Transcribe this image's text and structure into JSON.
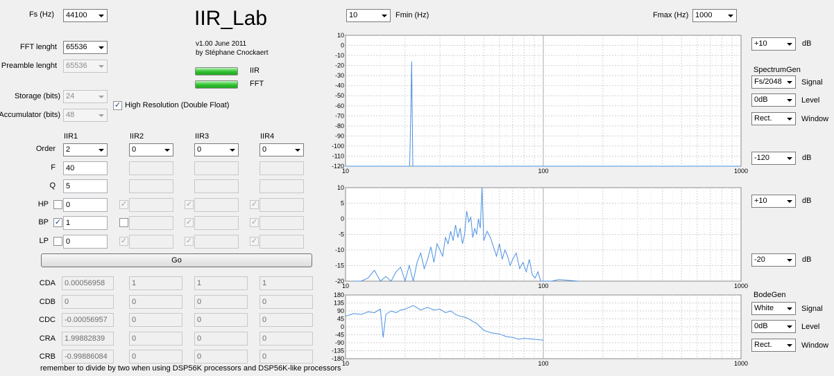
{
  "app": {
    "title": "IIR_Lab",
    "version": "v1.00 June 2011",
    "author": "by Stéphane Cnockaert"
  },
  "settings": {
    "fs_label": "Fs (Hz)",
    "fs_value": "44100",
    "fft_label": "FFT lenght",
    "fft_value": "65536",
    "preamble_label": "Preamble lenght",
    "preamble_value": "65536",
    "storage_label": "Storage (bits)",
    "storage_value": "24",
    "accumulator_label": "Accumulator (bits)",
    "accumulator_value": "48",
    "highres_label": "High Resolution (Double Float)",
    "highres_checked": "✓"
  },
  "indicators": {
    "iir": "IIR",
    "fft": "FFT",
    "green": "#2fc12f"
  },
  "filters": {
    "row_labels": {
      "order": "Order",
      "f": "F",
      "q": "Q",
      "hp": "HP",
      "bp": "BP",
      "lp": "LP"
    },
    "columns": [
      {
        "name": "IIR1",
        "order": "2",
        "f": "40",
        "q": "5",
        "hp": "0",
        "bp": "1",
        "lp": "0",
        "hp_chk": "",
        "bp_chk": "✓",
        "lp_chk": ""
      },
      {
        "name": "IIR2",
        "order": "0",
        "f": "",
        "q": "",
        "hp": "",
        "bp": "",
        "lp": "",
        "hp_chk": "✓",
        "bp_chk": "",
        "lp_chk": "✓"
      },
      {
        "name": "IIR3",
        "order": "0",
        "f": "",
        "q": "",
        "hp": "",
        "bp": "",
        "lp": "",
        "hp_chk": "✓",
        "bp_chk": "✓",
        "lp_chk": "✓"
      },
      {
        "name": "IIR4",
        "order": "0",
        "f": "",
        "q": "",
        "hp": "",
        "bp": "",
        "lp": "",
        "hp_chk": "✓",
        "bp_chk": "✓",
        "lp_chk": "✓"
      }
    ],
    "go_label": "Go"
  },
  "coefficients": {
    "labels": [
      "CDA",
      "CDB",
      "CDC",
      "CRA",
      "CRB"
    ],
    "values": [
      [
        "0.00056958",
        "1",
        "1",
        "1"
      ],
      [
        "0",
        "0",
        "0",
        "0"
      ],
      [
        "-0.00056957",
        "0",
        "0",
        "0"
      ],
      [
        "1.99882839",
        "0",
        "0",
        "0"
      ],
      [
        "-0.99886084",
        "0",
        "0",
        "0"
      ]
    ],
    "note": "remember to divide by two when using DSP56K processors and DSP56K-like processors"
  },
  "freq": {
    "fmin_value": "10",
    "fmin_label": "Fmin (Hz)",
    "fmax_label": "Fmax (Hz)",
    "fmax_value": "1000"
  },
  "right_panel": {
    "db_unit": "dB",
    "p1_top": "+10",
    "p1_bottom": "-120",
    "spectrumgen_title": "SpectrumGen",
    "sg_signal": "Fs/2048",
    "sg_level": "0dB",
    "sg_window": "Rect.",
    "signal_label": "Signal",
    "level_label": "Level",
    "window_label": "Window",
    "p2_top": "+10",
    "p2_bottom": "-20",
    "bodegen_title": "BodeGen",
    "bg_signal": "White",
    "bg_level": "0dB",
    "bg_window": "Rect."
  },
  "chart_data": [
    {
      "type": "line",
      "x_scale": "log",
      "xlim": [
        10,
        1000
      ],
      "ylim": [
        -120,
        10
      ],
      "x_ticks": [
        "10",
        "100",
        "1000"
      ],
      "y_ticks": [
        "10",
        "0",
        "-10",
        "-20",
        "-30",
        "-40",
        "-50",
        "-60",
        "-70",
        "-80",
        "-90",
        "-100",
        "-110",
        "-120"
      ],
      "series_color": "#4a90e2",
      "series": [
        {
          "x": [
            10,
            21.1,
            21.4,
            21.6,
            21.9,
            1000
          ],
          "y": [
            -120,
            -120,
            -65,
            -16,
            -120,
            -120
          ]
        }
      ]
    },
    {
      "type": "line",
      "x_scale": "log",
      "xlim": [
        10,
        1000
      ],
      "ylim": [
        -20,
        10
      ],
      "x_ticks": [
        "10",
        "100",
        "1000"
      ],
      "y_ticks": [
        "10",
        "5",
        "0",
        "-5",
        "-10",
        "-15",
        "-20"
      ],
      "series_color": "#4a90e2",
      "series": [
        {
          "x": [
            11,
            12,
            13,
            14,
            15,
            16,
            17,
            18,
            19,
            20,
            21,
            22,
            23,
            24,
            25,
            26,
            27,
            28,
            29,
            30,
            31,
            32,
            33,
            34,
            35,
            36,
            37,
            38,
            39,
            40,
            41,
            42,
            43,
            44,
            45,
            46,
            47,
            48,
            49,
            50,
            52,
            54,
            56,
            58,
            60,
            62,
            64,
            66,
            68,
            70,
            73,
            76,
            79,
            82,
            85,
            88,
            91,
            94,
            97,
            100,
            110,
            120,
            150
          ],
          "y": [
            -20,
            -20,
            -19,
            -16.5,
            -20,
            -18.5,
            -20,
            -17,
            -15.5,
            -20,
            -15,
            -20,
            -14,
            -11,
            -16,
            -13,
            -9,
            -14,
            -8,
            -10,
            -12,
            -6,
            -8,
            -4,
            -7,
            -2,
            -6,
            -3,
            -8,
            -5,
            2.5,
            -1,
            0.5,
            -6,
            -3,
            -5,
            0,
            -3,
            10,
            -7,
            -4,
            -6,
            -9,
            -12,
            -8,
            -13,
            -10,
            -12,
            -15,
            -13,
            -11,
            -16,
            -14,
            -17,
            -13,
            -18,
            -19,
            -17,
            -20,
            -20,
            -20,
            -19.5,
            -20
          ]
        }
      ]
    },
    {
      "type": "line",
      "x_scale": "log",
      "xlim": [
        10,
        1000
      ],
      "ylim": [
        -180,
        180
      ],
      "x_ticks": [
        "10",
        "100",
        "1000"
      ],
      "y_ticks": [
        "180",
        "135",
        "90",
        "45",
        "0",
        "-45",
        "-90",
        "-135",
        "-180"
      ],
      "series_color": "#4a90e2",
      "series": [
        {
          "x": [
            10,
            11,
            12,
            13,
            14,
            15,
            15.5,
            16,
            17,
            18,
            19,
            20,
            22,
            24,
            26,
            28,
            30,
            32,
            34,
            36,
            38,
            40,
            42,
            44,
            46,
            48,
            50,
            55,
            60,
            65,
            70,
            75,
            80,
            90,
            100
          ],
          "y": [
            60,
            75,
            70,
            85,
            80,
            100,
            -60,
            70,
            90,
            80,
            95,
            100,
            120,
            95,
            110,
            95,
            100,
            80,
            90,
            70,
            60,
            55,
            45,
            30,
            20,
            0,
            -20,
            -35,
            -40,
            -55,
            -60,
            -70,
            -65,
            -70,
            -75
          ]
        }
      ]
    }
  ]
}
